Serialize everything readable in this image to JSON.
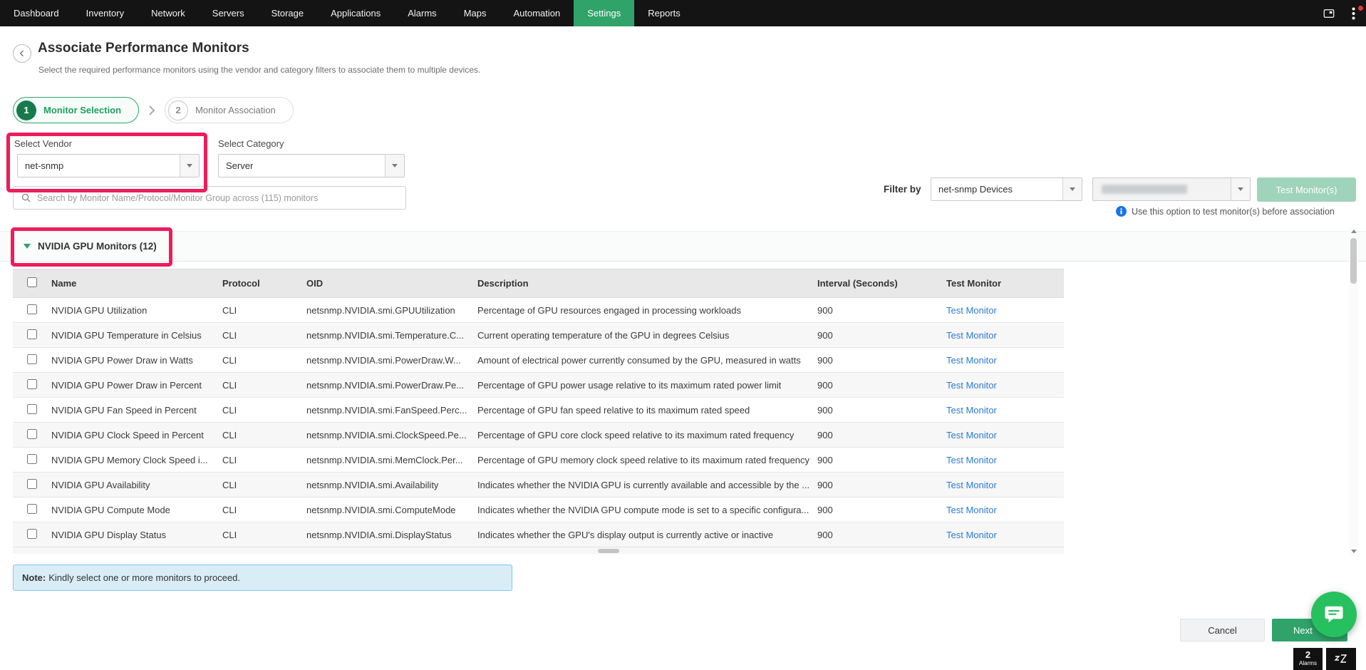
{
  "nav": {
    "items": [
      "Dashboard",
      "Inventory",
      "Network",
      "Servers",
      "Storage",
      "Applications",
      "Alarms",
      "Maps",
      "Automation",
      "Settings",
      "Reports"
    ],
    "active": "Settings"
  },
  "header": {
    "title": "Associate Performance Monitors",
    "subtitle": "Select the required performance monitors using the vendor and category filters to associate them to multiple devices."
  },
  "steps": [
    {
      "number": "1",
      "label": "Monitor Selection"
    },
    {
      "number": "2",
      "label": "Monitor Association"
    }
  ],
  "filters": {
    "vendor_label": "Select Vendor",
    "vendor_value": "net-snmp",
    "category_label": "Select Category",
    "category_value": "Server",
    "search_placeholder": "Search by Monitor Name/Protocol/Monitor Group across (115) monitors",
    "filter_by_label": "Filter by",
    "device_filter_value": "net-snmp Devices",
    "test_button_label": "Test Monitor(s)",
    "test_hint": "Use this option to test monitor(s) before association"
  },
  "section": {
    "title": "NVIDIA GPU Monitors (12)"
  },
  "table": {
    "headers": [
      "Name",
      "Protocol",
      "OID",
      "Description",
      "Interval (Seconds)",
      "Test Monitor"
    ],
    "test_link_label": "Test Monitor",
    "rows": [
      {
        "name": "NVIDIA GPU Utilization",
        "protocol": "CLI",
        "oid": "netsnmp.NVIDIA.smi.GPUUtilization",
        "description": "Percentage of GPU resources engaged in processing workloads",
        "interval": "900"
      },
      {
        "name": "NVIDIA GPU Temperature in Celsius",
        "protocol": "CLI",
        "oid": "netsnmp.NVIDIA.smi.Temperature.C...",
        "description": "Current operating temperature of the GPU in degrees Celsius",
        "interval": "900"
      },
      {
        "name": "NVIDIA GPU Power Draw in Watts",
        "protocol": "CLI",
        "oid": "netsnmp.NVIDIA.smi.PowerDraw.W...",
        "description": "Amount of electrical power currently consumed by the GPU, measured in watts",
        "interval": "900"
      },
      {
        "name": "NVIDIA GPU Power Draw in Percent",
        "protocol": "CLI",
        "oid": "netsnmp.NVIDIA.smi.PowerDraw.Pe...",
        "description": "Percentage of GPU power usage relative to its maximum rated power limit",
        "interval": "900"
      },
      {
        "name": "NVIDIA GPU Fan Speed in Percent",
        "protocol": "CLI",
        "oid": "netsnmp.NVIDIA.smi.FanSpeed.Perc...",
        "description": "Percentage of GPU fan speed relative to its maximum rated speed",
        "interval": "900"
      },
      {
        "name": "NVIDIA GPU Clock Speed in Percent",
        "protocol": "CLI",
        "oid": "netsnmp.NVIDIA.smi.ClockSpeed.Pe...",
        "description": "Percentage of GPU core clock speed relative to its maximum rated frequency",
        "interval": "900"
      },
      {
        "name": "NVIDIA GPU Memory Clock Speed i...",
        "protocol": "CLI",
        "oid": "netsnmp.NVIDIA.smi.MemClock.Per...",
        "description": "Percentage of GPU memory clock speed relative to its maximum rated frequency",
        "interval": "900"
      },
      {
        "name": "NVIDIA GPU Availability",
        "protocol": "CLI",
        "oid": "netsnmp.NVIDIA.smi.Availability",
        "description": "Indicates whether the NVIDIA GPU is currently available and accessible by the ...",
        "interval": "900"
      },
      {
        "name": "NVIDIA GPU Compute Mode",
        "protocol": "CLI",
        "oid": "netsnmp.NVIDIA.smi.ComputeMode",
        "description": "Indicates whether the NVIDIA GPU compute mode is set to a specific configura...",
        "interval": "900"
      },
      {
        "name": "NVIDIA GPU Display Status",
        "protocol": "CLI",
        "oid": "netsnmp.NVIDIA.smi.DisplayStatus",
        "description": "Indicates whether the GPU's display output is currently active or inactive",
        "interval": "900"
      }
    ]
  },
  "note": {
    "prefix": "Note:",
    "text": "Kindly select one or more monitors to proceed."
  },
  "footer": {
    "cancel_label": "Cancel",
    "next_label": "Next"
  },
  "badges": {
    "alarm_count": "2",
    "alarm_label": "Alarms"
  },
  "colors": {
    "accent_green": "#2fa36a",
    "annotation_red": "#ee1c5c",
    "link_blue": "#2b7bd6",
    "note_bg": "#d9edf7",
    "nav_bg": "#141414",
    "chat_green": "#27c05f"
  }
}
